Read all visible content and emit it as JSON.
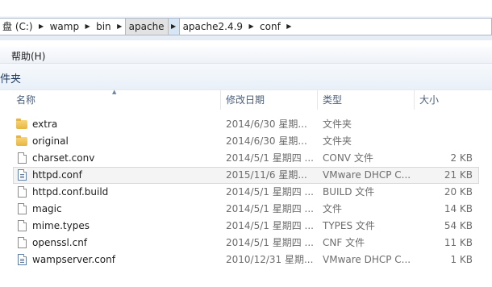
{
  "address_bar": {
    "crumbs": [
      "盘 (C:)",
      "wamp",
      "bin",
      "apache",
      "apache2.4.9",
      "conf"
    ],
    "active_crumb": "apache"
  },
  "menu": {
    "help": "帮助(H)"
  },
  "library": {
    "title": "件夹"
  },
  "columns": {
    "name": "名称",
    "date": "修改日期",
    "type": "类型",
    "size": "大小"
  },
  "files": [
    {
      "name": "extra",
      "date": "2014/6/30 星期...",
      "type": "文件夹",
      "size": "",
      "icon": "folder-icon"
    },
    {
      "name": "original",
      "date": "2014/6/30 星期...",
      "type": "文件夹",
      "size": "",
      "icon": "folder-icon"
    },
    {
      "name": "charset.conv",
      "date": "2014/5/1 星期四 ...",
      "type": "CONV 文件",
      "size": "2 KB",
      "icon": "file-icon"
    },
    {
      "name": "httpd.conf",
      "date": "2015/11/6 星期...",
      "type": "VMware DHCP C...",
      "size": "21 KB",
      "icon": "config-file-icon",
      "selected": true
    },
    {
      "name": "httpd.conf.build",
      "date": "2014/5/1 星期四 ...",
      "type": "BUILD 文件",
      "size": "20 KB",
      "icon": "file-icon"
    },
    {
      "name": "magic",
      "date": "2014/5/1 星期四 ...",
      "type": "文件",
      "size": "14 KB",
      "icon": "file-icon"
    },
    {
      "name": "mime.types",
      "date": "2014/5/1 星期四 ...",
      "type": "TYPES 文件",
      "size": "54 KB",
      "icon": "file-icon"
    },
    {
      "name": "openssl.cnf",
      "date": "2014/5/1 星期四 ...",
      "type": "CNF 文件",
      "size": "11 KB",
      "icon": "file-icon"
    },
    {
      "name": "wampserver.conf",
      "date": "2010/12/31 星期...",
      "type": "VMware DHCP C...",
      "size": "1 KB",
      "icon": "config-file-icon"
    }
  ]
}
